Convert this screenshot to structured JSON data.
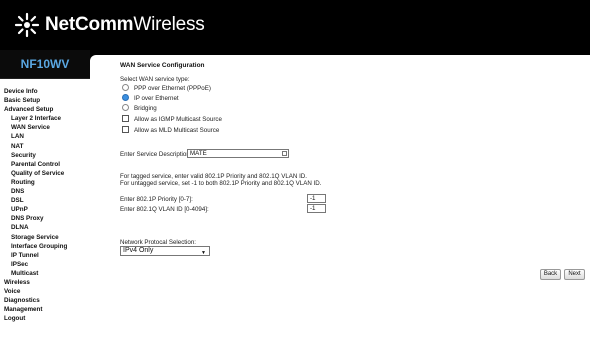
{
  "brand": {
    "name_bold": "NetComm",
    "name_rest": "Wireless",
    "model": "NF10WV"
  },
  "nav": [
    {
      "label": "Device Info",
      "sub": false
    },
    {
      "label": "Basic Setup",
      "sub": false
    },
    {
      "label": "Advanced Setup",
      "sub": false
    },
    {
      "label": "Layer 2 Interface",
      "sub": true
    },
    {
      "label": "WAN Service",
      "sub": true
    },
    {
      "label": "LAN",
      "sub": true
    },
    {
      "label": "NAT",
      "sub": true
    },
    {
      "label": "Security",
      "sub": true
    },
    {
      "label": "Parental Control",
      "sub": true
    },
    {
      "label": "Quality of Service",
      "sub": true
    },
    {
      "label": "Routing",
      "sub": true
    },
    {
      "label": "DNS",
      "sub": true
    },
    {
      "label": "DSL",
      "sub": true
    },
    {
      "label": "UPnP",
      "sub": true
    },
    {
      "label": "DNS Proxy",
      "sub": true
    },
    {
      "label": "DLNA",
      "sub": true
    },
    {
      "label": "Storage Service",
      "sub": true
    },
    {
      "label": "Interface Grouping",
      "sub": true
    },
    {
      "label": "IP Tunnel",
      "sub": true
    },
    {
      "label": "IPSec",
      "sub": true
    },
    {
      "label": "Multicast",
      "sub": true
    },
    {
      "label": "Wireless",
      "sub": false
    },
    {
      "label": "Voice",
      "sub": false
    },
    {
      "label": "Diagnostics",
      "sub": false
    },
    {
      "label": "Management",
      "sub": false
    },
    {
      "label": "Logout",
      "sub": false
    }
  ],
  "form": {
    "title": "WAN Service Configuration",
    "service_type_label": "Select WAN service type:",
    "options": {
      "pppoe": "PPP over Ethernet (PPPoE)",
      "ipoe": "IP over Ethernet",
      "bridging": "Bridging"
    },
    "selected_option": "ipoe",
    "igmp_label": "Allow as IGMP Multicast Source",
    "mld_label": "Allow as MLD Multicast Source",
    "igmp_checked": false,
    "mld_checked": false,
    "service_desc_label": "Enter Service Description:",
    "service_desc_value": "MATE",
    "vlan_note_1": "For tagged service, enter valid 802.1P Priority and 802.1Q VLAN ID.",
    "vlan_note_2": "For untagged service, set -1 to both 802.1P Priority and 802.1Q VLAN ID.",
    "priority_label": "Enter 802.1P Priority [0-7]:",
    "priority_value": "-1",
    "vlan_label": "Enter 802.1Q VLAN ID [0-4094]:",
    "vlan_value": "-1",
    "protocol_label": "Network Protocal Selection:",
    "protocol_value": "IPv4 Only",
    "back_label": "Back",
    "next_label": "Next"
  },
  "colors": {
    "accent": "#3b8fe0",
    "model": "#5aa7e2"
  }
}
